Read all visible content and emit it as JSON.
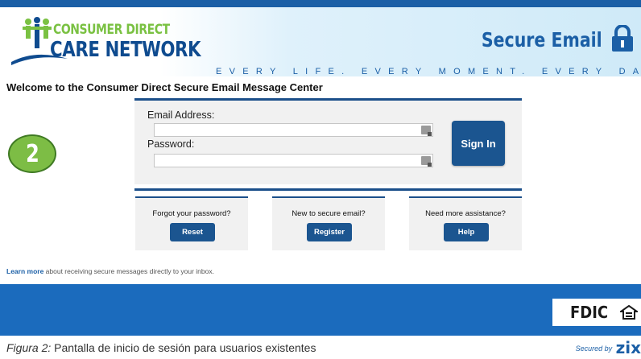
{
  "header": {
    "logo_line1": "CONSUMER DIRECT",
    "logo_line2": "CARE NETWORK",
    "title": "Secure Email",
    "tagline": "EVERY LIFE. EVERY MOMENT. EVERY DAY."
  },
  "welcome": "Welcome to the Consumer Direct Secure Email Message Center",
  "step_badge": "2",
  "login": {
    "email_label": "Email Address:",
    "email_value": "",
    "password_label": "Password:",
    "password_value": "",
    "signin_label": "Sign In"
  },
  "help_boxes": [
    {
      "question": "Forgot your password?",
      "button": "Reset"
    },
    {
      "question": "New to secure email?",
      "button": "Register"
    },
    {
      "question": "Need more assistance?",
      "button": "Help"
    }
  ],
  "learn_more": {
    "link": "Learn more",
    "text": " about receiving secure messages directly to your inbox."
  },
  "footer": {
    "fdic": "FDIC",
    "secured_by": "Secured by",
    "zix": "zix"
  },
  "caption": {
    "label": "Figura 2:",
    "text": " Pantalla de inicio de sesión para usuarios existentes"
  },
  "colors": {
    "brand_blue": "#1b5fa6",
    "brand_green": "#7ac142",
    "button_blue": "#1b5590",
    "footer_blue": "#1b6bbd"
  }
}
